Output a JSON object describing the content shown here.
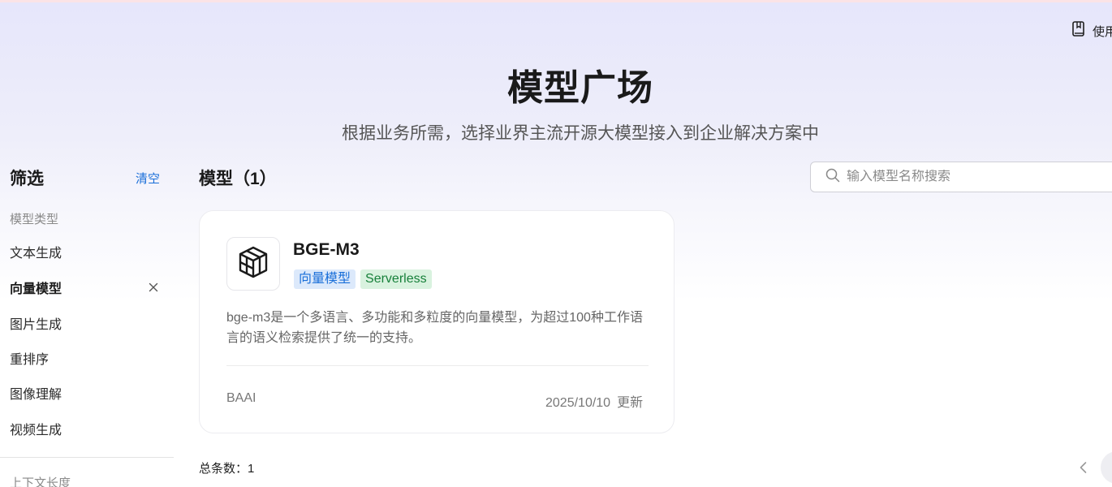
{
  "header": {
    "guide_label": "使用指南",
    "title": "模型广场",
    "subtitle": "根据业务所需，选择业界主流开源大模型接入到企业解决方案中"
  },
  "sidebar": {
    "title": "筛选",
    "clear_label": "清空",
    "group_label": "模型类型",
    "items": [
      {
        "label": "文本生成"
      },
      {
        "label": "向量模型"
      },
      {
        "label": "图片生成"
      },
      {
        "label": "重排序"
      },
      {
        "label": "图像理解"
      },
      {
        "label": "视频生成"
      }
    ],
    "active_index": 1,
    "next_group_label": "上下文长度"
  },
  "main": {
    "heading": "模型（1）",
    "search_placeholder": "输入模型名称搜索",
    "search_value": "",
    "cards": [
      {
        "name": "BGE-M3",
        "tags": [
          "向量模型",
          "Serverless"
        ],
        "description": "bge-m3是一个多语言、多功能和多粒度的向量模型，为超过100种工作语言的语义检索提供了统一的支持。",
        "provider": "BAAI",
        "date": "2025/10/10",
        "updated_label": "更新"
      }
    ],
    "total_text": "总条数：1"
  },
  "colors": {
    "accent": "#1a6fd9",
    "tag_blue_bg": "#dce9fb",
    "tag_green_bg": "#d9f2df",
    "tag_green_text": "#17803a"
  }
}
